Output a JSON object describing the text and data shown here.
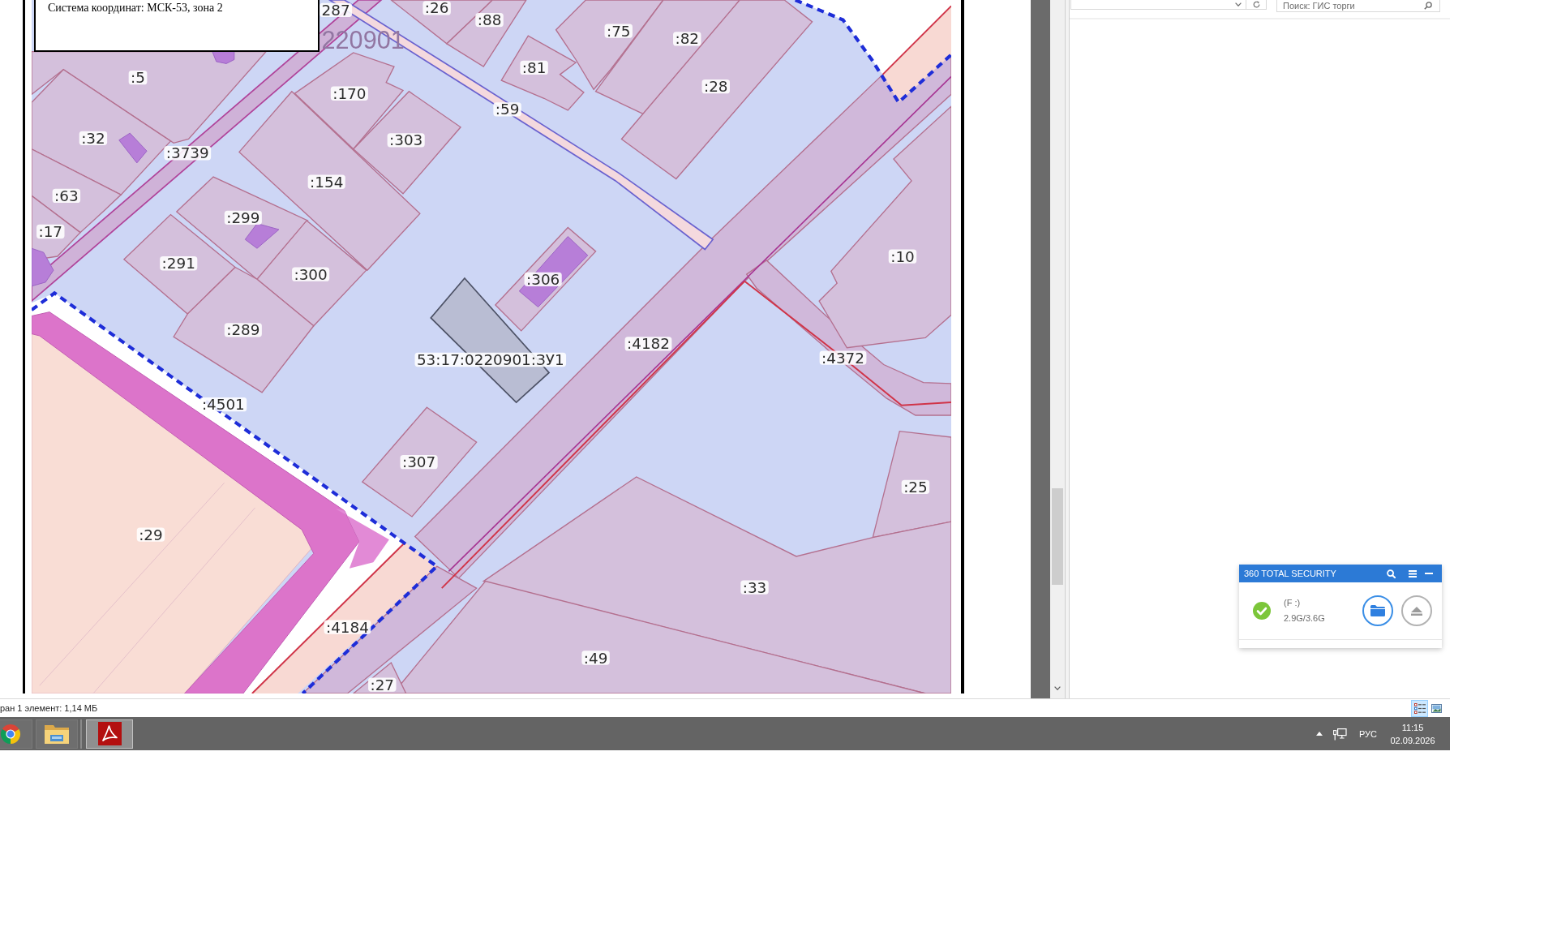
{
  "document": {
    "caption": "Система координат: МСК-53, зона 2",
    "map": {
      "block_number": "220901",
      "parcel_labels": [
        "287",
        ":26",
        ":88",
        ":75",
        ":82",
        ":81",
        ":28",
        ":5",
        ":170",
        ":59",
        ":32",
        ":3739",
        ":303",
        ":154",
        ":63",
        ":299",
        ":17",
        ":10",
        ":306",
        ":291",
        ":300",
        ":289",
        ":4182",
        "53:17:0220901:ЗУ1",
        ":4372",
        ":4501",
        ":307",
        ":25",
        ":29",
        ":33",
        ":4184",
        ":49",
        ":27"
      ]
    }
  },
  "explorer": {
    "search": {
      "placeholder": "Поиск: ГИС торги"
    },
    "status_text": "ран 1 элемент: 1,14 МБ",
    "views": [
      {
        "kind": "details",
        "selected": true
      },
      {
        "kind": "thumbnails",
        "selected": false
      }
    ]
  },
  "security_widget": {
    "title": "360 TOTAL SECURITY",
    "drive": "(F :)",
    "usage": "2.9G/3.6G"
  },
  "taskbar": {
    "apps": [
      {
        "kind": "browser",
        "selected": false
      },
      {
        "kind": "files",
        "selected": false
      },
      {
        "kind": "reader",
        "selected": true
      }
    ],
    "language": "РУС",
    "time": "11:15",
    "date": "02.09.2026"
  }
}
